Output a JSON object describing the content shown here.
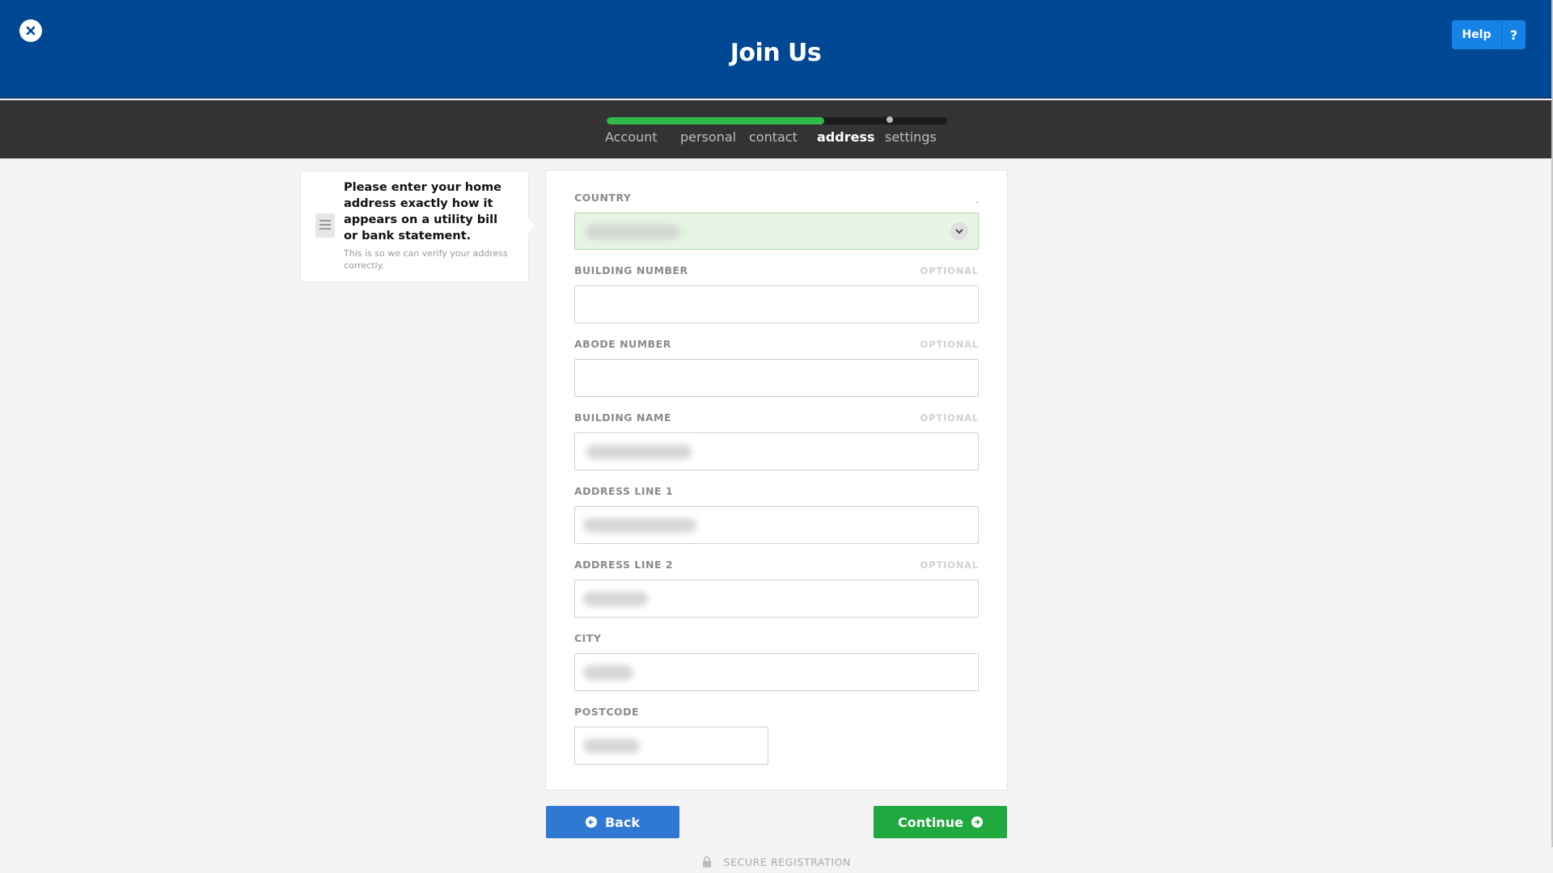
{
  "header": {
    "title": "Join Us",
    "help_label": "Help",
    "help_icon": "?"
  },
  "progress": {
    "steps": [
      "Account",
      "personal",
      "contact",
      "address",
      "settings"
    ],
    "active_step": "address",
    "percent": 64
  },
  "info": {
    "main": "Please enter your home address exactly how it appears on a utility bill or bank statement.",
    "sub": "This is so we can verify your address correctly."
  },
  "form": {
    "optional_label": "OPTIONAL",
    "required_mark": ".",
    "country_label": "COUNTRY",
    "building_number_label": "BUILDING NUMBER",
    "abode_number_label": "ABODE NUMBER",
    "building_name_label": "BUILDING NAME",
    "address_line_1_label": "ADDRESS LINE 1",
    "address_line_2_label": "ADDRESS LINE 2",
    "city_label": "CITY",
    "postcode_label": "POSTCODE"
  },
  "buttons": {
    "back": "Back",
    "continue": "Continue"
  },
  "footer": {
    "secure": "SECURE REGISTRATION"
  },
  "colors": {
    "header_bg": "#004893",
    "progress_fill": "#2fba4a",
    "back_button": "#3079d3",
    "continue_button": "#1fa93e",
    "help_button": "#1583e6"
  }
}
